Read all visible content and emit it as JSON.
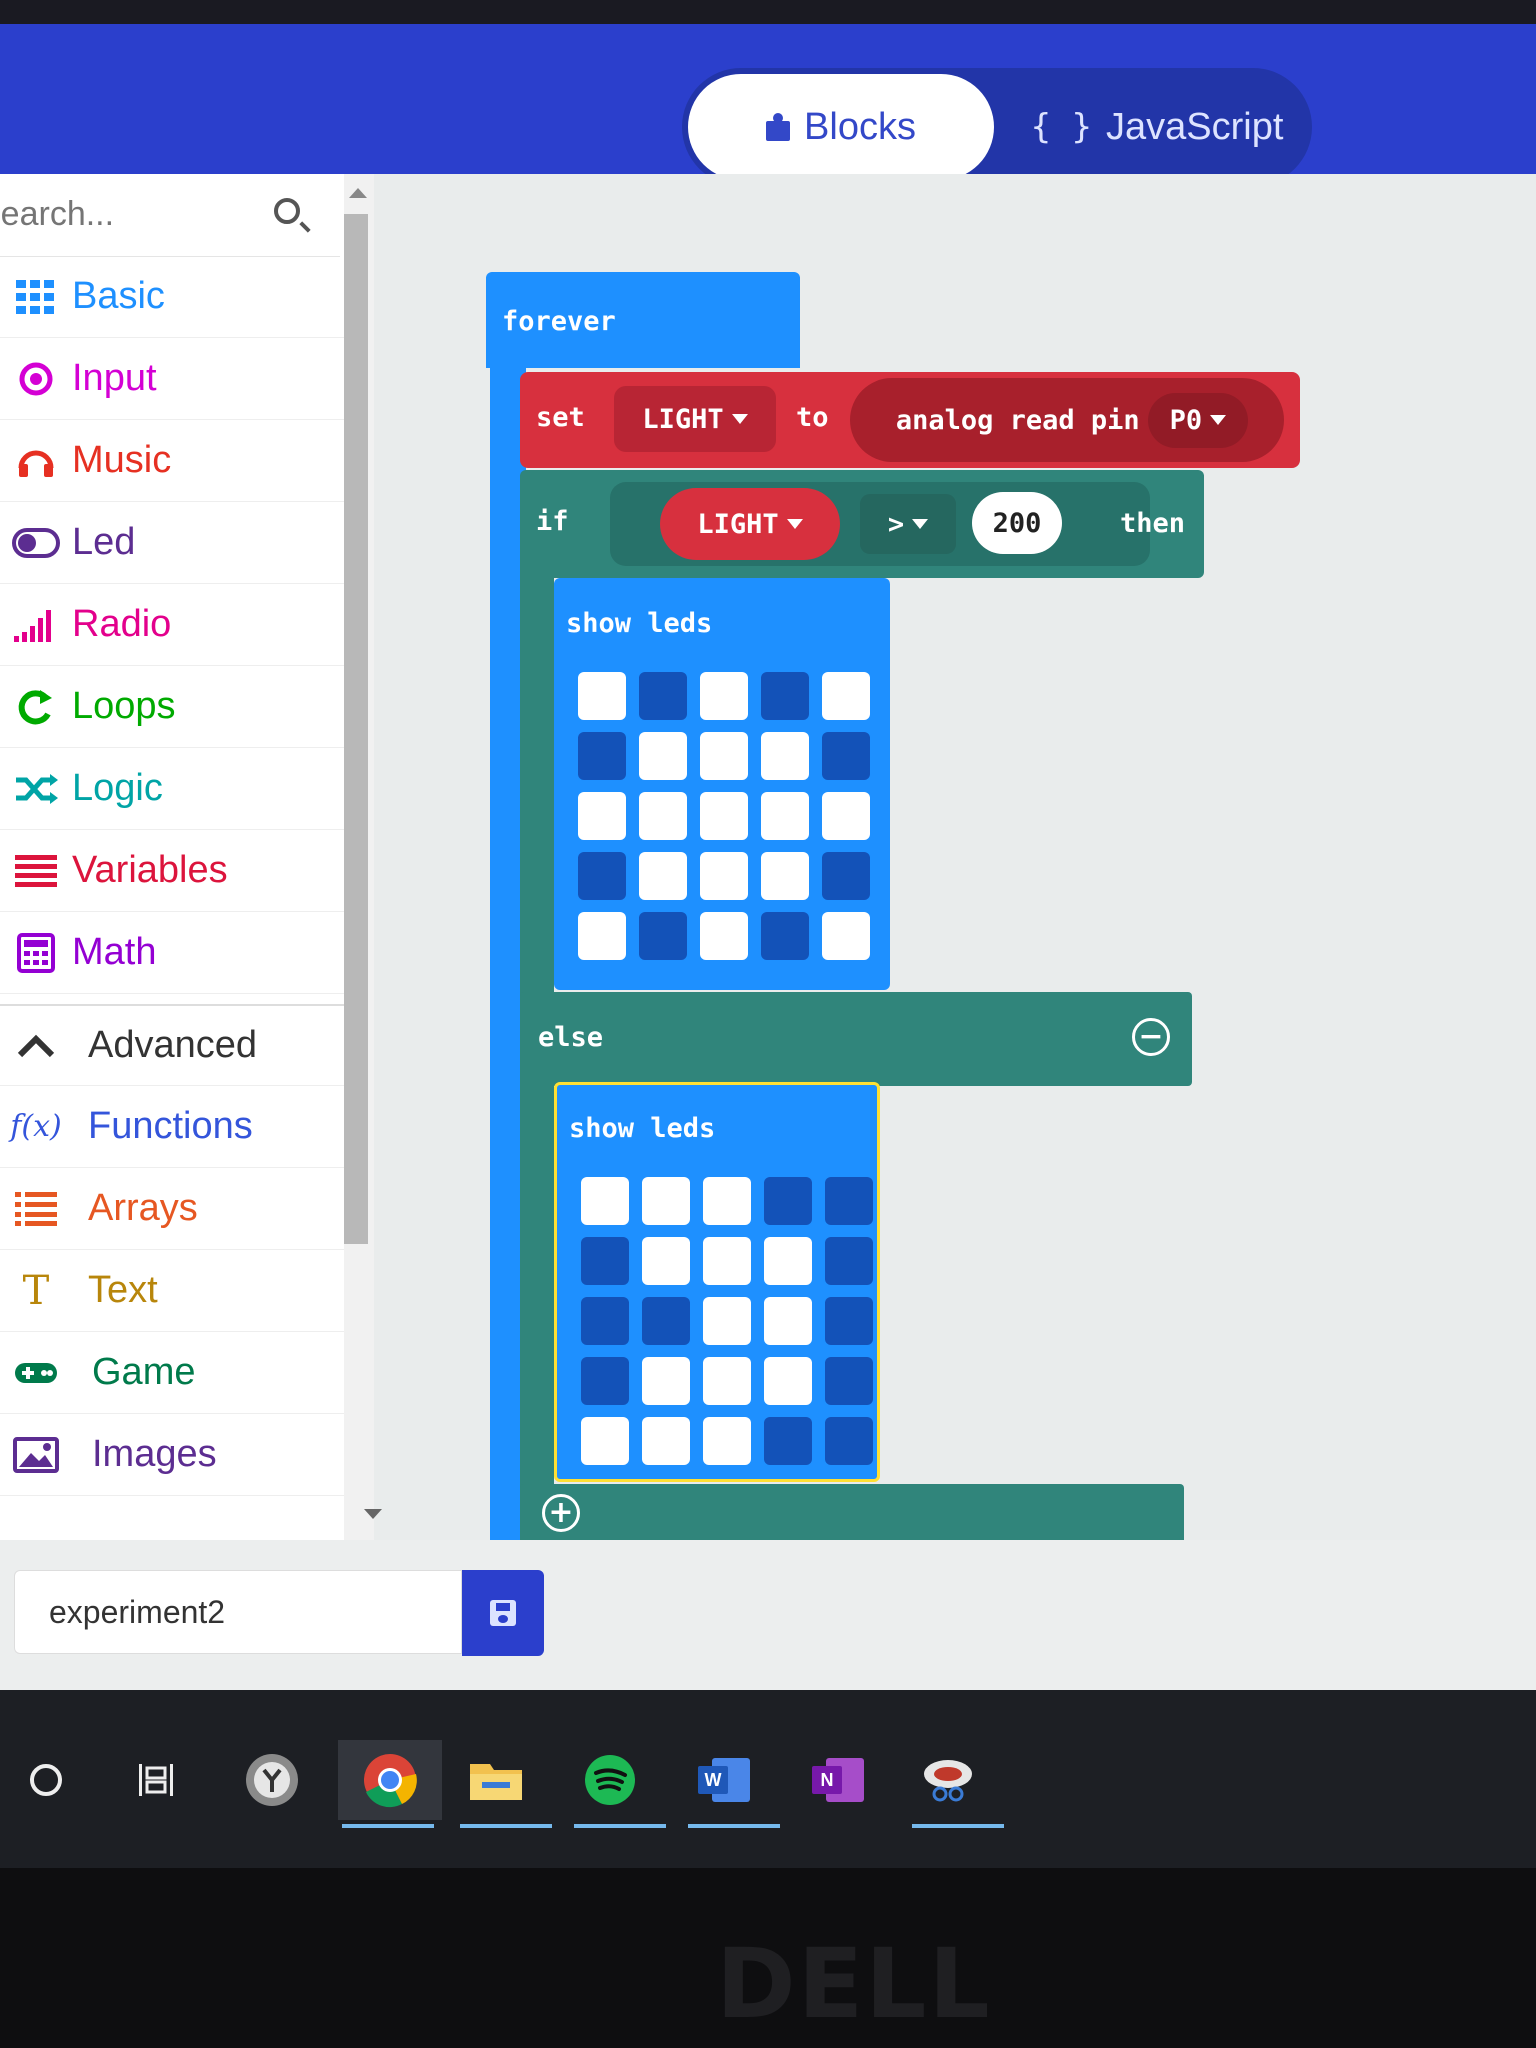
{
  "header": {
    "tabs": [
      {
        "label": "Blocks",
        "icon": "puzzle-icon",
        "active": true
      },
      {
        "label": "JavaScript",
        "icon": "braces-icon",
        "active": false
      }
    ],
    "accent": "#2b3fcc"
  },
  "toolbox": {
    "search_placeholder": "Search...",
    "categories": [
      {
        "label": "Basic",
        "icon": "grid-icon",
        "color": "#1e90ff"
      },
      {
        "label": "Input",
        "icon": "target-icon",
        "color": "#d400d4"
      },
      {
        "label": "Music",
        "icon": "headphones-icon",
        "color": "#e63022"
      },
      {
        "label": "Led",
        "icon": "toggle-icon",
        "color": "#5c2d91"
      },
      {
        "label": "Radio",
        "icon": "signal-icon",
        "color": "#e3008c"
      },
      {
        "label": "Loops",
        "icon": "loop-arrow-icon",
        "color": "#00aa00"
      },
      {
        "label": "Logic",
        "icon": "shuffle-icon",
        "color": "#00a4a6"
      },
      {
        "label": "Variables",
        "icon": "lines-icon",
        "color": "#dc143c"
      },
      {
        "label": "Math",
        "icon": "calculator-icon",
        "color": "#9400d3"
      },
      {
        "label": "Advanced",
        "icon": "chevron-up-icon",
        "color": "#333333"
      },
      {
        "label": "Functions",
        "icon": "function-icon",
        "color": "#3455db"
      },
      {
        "label": "Arrays",
        "icon": "list-icon",
        "color": "#e65722"
      },
      {
        "label": "Text",
        "icon": "text-icon",
        "color": "#b8860b"
      },
      {
        "label": "Game",
        "icon": "gamepad-icon",
        "color": "#007a4b"
      },
      {
        "label": "Images",
        "icon": "image-icon",
        "color": "#5c2d91"
      }
    ]
  },
  "blocks": {
    "forever": "forever",
    "set": "set",
    "variable": "LIGHT",
    "to": "to",
    "analog_read": "analog read pin",
    "pin": "P0",
    "if": "if",
    "operator": ">",
    "threshold": "200",
    "then": "then",
    "else": "else",
    "show_leds": "show leds",
    "leds_then": [
      [
        1,
        0,
        1,
        0,
        1
      ],
      [
        0,
        1,
        1,
        1,
        0
      ],
      [
        1,
        1,
        1,
        1,
        1
      ],
      [
        0,
        1,
        1,
        1,
        0
      ],
      [
        1,
        0,
        1,
        0,
        1
      ]
    ],
    "leds_else": [
      [
        1,
        1,
        1,
        0,
        0
      ],
      [
        0,
        1,
        1,
        1,
        0
      ],
      [
        0,
        0,
        1,
        1,
        0
      ],
      [
        0,
        1,
        1,
        1,
        0
      ],
      [
        1,
        1,
        1,
        0,
        0
      ]
    ],
    "colors": {
      "loops": "#1e90ff",
      "variables": "#d7303e",
      "logic": "#30857b"
    }
  },
  "footer": {
    "project_name": "experiment2"
  },
  "taskbar": {
    "items": [
      "cortana-icon",
      "task-view-icon",
      "clock-app-icon",
      "chrome-icon",
      "file-explorer-icon",
      "spotify-icon",
      "word-icon",
      "onenote-icon",
      "snipping-tool-icon"
    ]
  },
  "brand": "DELL"
}
